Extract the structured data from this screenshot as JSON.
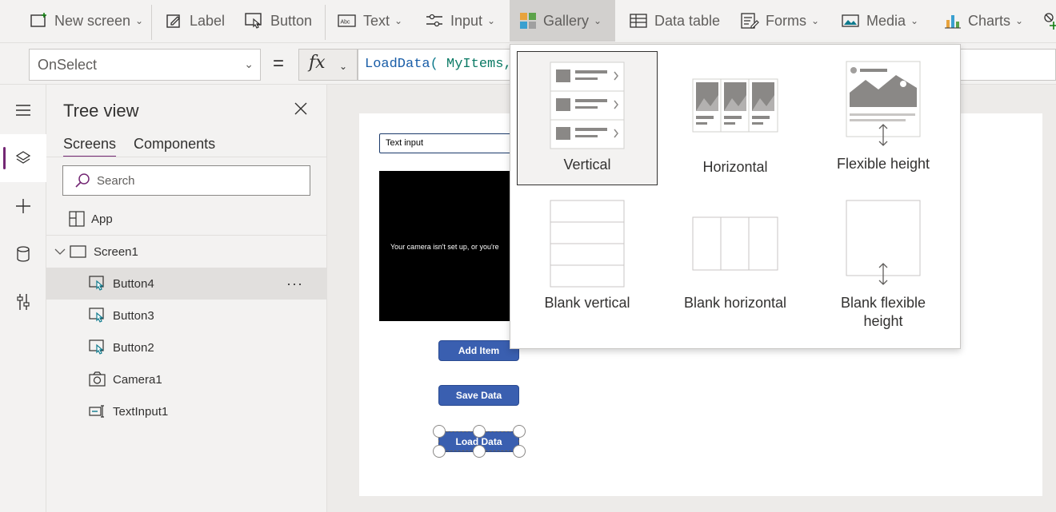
{
  "ribbon": {
    "items": [
      {
        "label": "New screen"
      },
      {
        "label": "Label"
      },
      {
        "label": "Button"
      },
      {
        "label": "Text"
      },
      {
        "label": "Input"
      },
      {
        "label": "Gallery"
      },
      {
        "label": "Data table"
      },
      {
        "label": "Forms"
      },
      {
        "label": "Media"
      },
      {
        "label": "Charts"
      }
    ]
  },
  "formula": {
    "property": "OnSelect",
    "equals": "=",
    "fx": "fx",
    "fn": "LoadData",
    "arg": "MyItems,"
  },
  "tree": {
    "title": "Tree view",
    "tabs": [
      "Screens",
      "Components"
    ],
    "search_placeholder": "Search",
    "app_label": "App",
    "screen_label": "Screen1",
    "children": [
      "Button4",
      "Button3",
      "Button2",
      "Camera1",
      "TextInput1"
    ],
    "more": "···"
  },
  "canvas": {
    "text_input": "Text input",
    "camera_message": "Your camera isn't set up, or you're",
    "buttons": [
      "Add Item",
      "Save Data",
      "Load Data"
    ]
  },
  "gallery_menu": {
    "options": [
      "Vertical",
      "Horizontal",
      "Flexible height",
      "Blank vertical",
      "Blank horizontal",
      "Blank flexible height"
    ]
  },
  "colors": {
    "accent": "#742774",
    "app_button": "#3a5fb0",
    "ribbon_bg": "#f3f2f1"
  }
}
